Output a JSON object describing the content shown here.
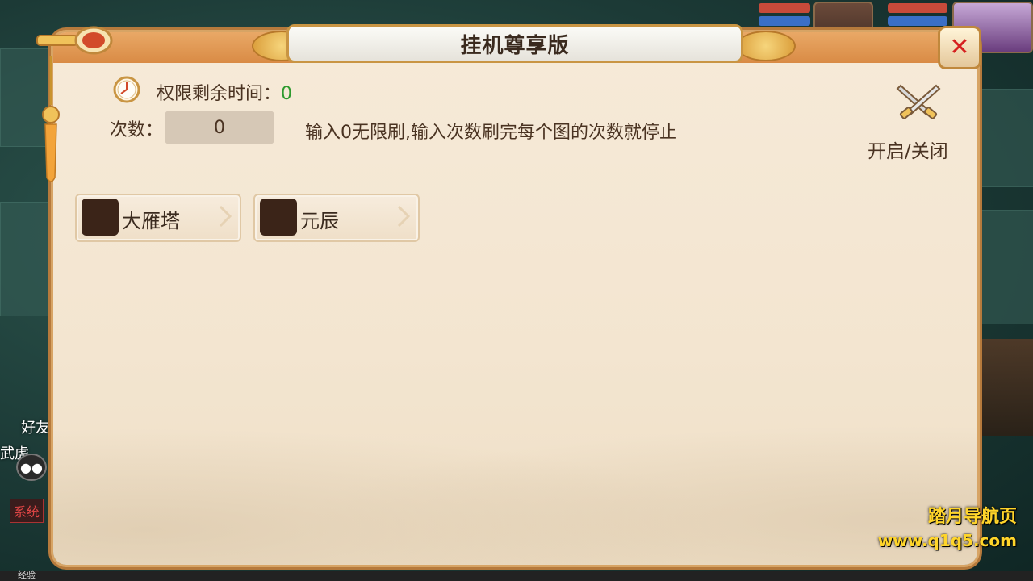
{
  "background": {
    "friends_label": "好友",
    "side_text": "武虎",
    "system_label": "系统",
    "exp_label": "经验"
  },
  "dialog": {
    "title": "挂机尊享版",
    "remaining_time_label": "权限剩余时间：",
    "remaining_time_value": "0",
    "count_label": "次数：",
    "count_value": "0",
    "hint": "输入0无限刷,输入次数刷完每个图的次数就停止",
    "toggle_label": "开启/关闭",
    "maps": [
      {
        "name": "大雁塔"
      },
      {
        "name": "元辰"
      }
    ]
  },
  "watermark": {
    "line1": "踏月导航页",
    "line2": "www.q1q5.com"
  },
  "colors": {
    "accent": "#d98b45",
    "green_value": "#2e9a2e",
    "close_red": "#d62020"
  }
}
